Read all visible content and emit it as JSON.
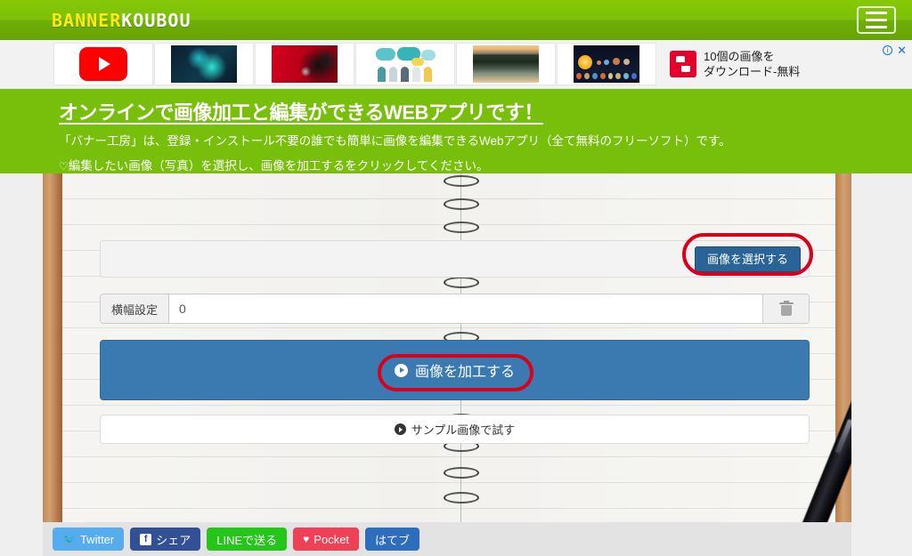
{
  "header": {
    "logo_primary": "BANNER",
    "logo_secondary": "KOUBOU",
    "menu_icon": "hamburger-menu-icon"
  },
  "ads": {
    "thumbnails": [
      {
        "name": "youtube-logo-thumbnail"
      },
      {
        "name": "teal-abstract-thumbnail"
      },
      {
        "name": "red-black-abstract-thumbnail"
      },
      {
        "name": "people-speech-bubbles-thumbnail"
      },
      {
        "name": "mountain-lake-thumbnail"
      },
      {
        "name": "solar-system-thumbnail"
      }
    ],
    "headline_line1": "10個の画像を",
    "headline_line2": "ダウンロード-無料",
    "info_glyph": "i",
    "close_glyph": "✕",
    "brand_color": "#e4002b"
  },
  "promo": {
    "heading": "オンラインで画像加工と編集ができるWEBアプリです！",
    "line1": "「バナー工房」は、登録・インストール不要の誰でも簡単に画像を編集できるWebアプリ（全て無料のフリーソフト）です。",
    "heart_glyph": "♡",
    "line2": "編集したい画像（写真）を選択し、画像を加工するをクリックしてください。",
    "band_color": "#77bf0a"
  },
  "form": {
    "file_input_value": "",
    "select_image_label": "画像を選択する",
    "width_label": "横幅設定",
    "width_value": "0",
    "width_placeholder": "0",
    "trash_icon": "trash-icon",
    "process_label": "画像を加工する",
    "sample_label": "サンプル画像で試す",
    "primary_button_color": "#2a6496",
    "process_button_color": "#3a7ab0",
    "highlight_color": "#d9001b"
  },
  "social": {
    "buttons": [
      {
        "label": "Twitter",
        "icon": "twitter-bird-icon",
        "glyph": "🐦"
      },
      {
        "label": "シェア",
        "icon": "facebook-icon",
        "glyph": "f"
      },
      {
        "label": "LINEで送る",
        "icon": "line-icon",
        "glyph": ""
      },
      {
        "label": "Pocket",
        "icon": "pocket-icon",
        "glyph": "♥"
      },
      {
        "label": "はてブ",
        "icon": "hatena-icon",
        "glyph": ""
      }
    ]
  },
  "background": {
    "description": "notebook-spiral-background",
    "pen": "black-pen"
  }
}
